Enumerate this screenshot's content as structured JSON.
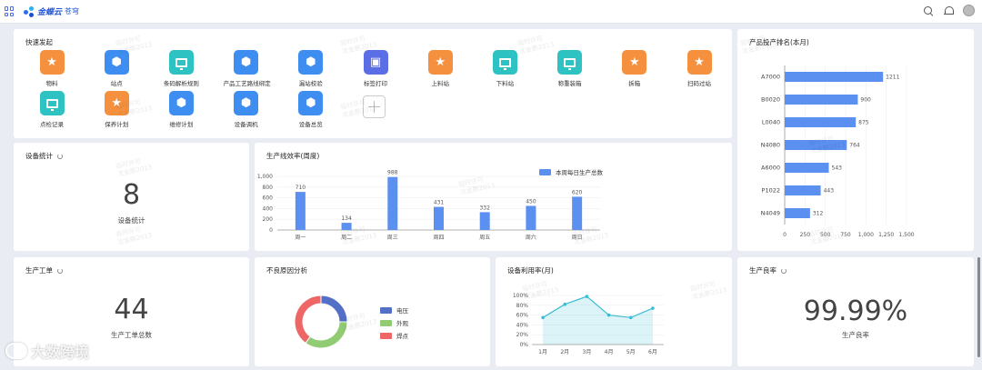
{
  "topbar": {
    "logo_text": "金蝶云",
    "logo_sub": "苍穹"
  },
  "quick_actions": {
    "title": "快速发起",
    "items": [
      {
        "label": "物料",
        "icon": "star-icon",
        "color": "#f5913e"
      },
      {
        "label": "站点",
        "icon": "cube-icon",
        "color": "#3e8ef2"
      },
      {
        "label": "条码解析规则",
        "icon": "monitor-icon",
        "color": "#2fc2c2"
      },
      {
        "label": "产品工艺路线绑定",
        "icon": "cube-icon",
        "color": "#3e8ef2"
      },
      {
        "label": "漏站校验",
        "icon": "cube-icon",
        "color": "#3e8ef2"
      },
      {
        "label": "标签打印",
        "icon": "box-icon",
        "color": "#5b6ee6"
      },
      {
        "label": "上料站",
        "icon": "star-icon",
        "color": "#f5913e"
      },
      {
        "label": "下料站",
        "icon": "monitor-icon",
        "color": "#2fc2c2"
      },
      {
        "label": "称重装箱",
        "icon": "monitor-icon",
        "color": "#2fc2c2"
      },
      {
        "label": "拆箱",
        "icon": "star-icon",
        "color": "#f5913e"
      },
      {
        "label": "扫码过站",
        "icon": "star-icon",
        "color": "#f5913e"
      },
      {
        "label": "点检记录",
        "icon": "monitor-icon",
        "color": "#2fc2c2"
      },
      {
        "label": "保养计划",
        "icon": "star-icon",
        "color": "#f5913e"
      },
      {
        "label": "维修计划",
        "icon": "cube-icon",
        "color": "#3e8ef2"
      },
      {
        "label": "设备调机",
        "icon": "cube-icon",
        "color": "#3e8ef2"
      },
      {
        "label": "设备总览",
        "icon": "cube-icon",
        "color": "#3e8ef2"
      }
    ]
  },
  "device_stats": {
    "title": "设备统计",
    "value": "8",
    "label": "设备统计"
  },
  "work_orders": {
    "title": "生产工单",
    "value": "44",
    "label": "生产工单总数"
  },
  "yield": {
    "title": "生产良率",
    "value": "99.99%",
    "label": "生产良率"
  },
  "watermark_lines": [
    "临时许可",
    "沈金鹏2013"
  ],
  "brand_overlay": "大数跨境",
  "chart_data": [
    {
      "type": "bar",
      "title": "生产线效率(周度)",
      "categories": [
        "周一",
        "周二",
        "周三",
        "周四",
        "周五",
        "周六",
        "周日"
      ],
      "series": [
        {
          "name": "本周每日生产总数",
          "values": [
            710,
            134,
            988,
            431,
            332,
            450,
            620
          ]
        }
      ],
      "ylim": [
        0,
        1000
      ],
      "yticks": [
        "0",
        "200",
        "400",
        "600",
        "800",
        "1,000"
      ],
      "color": "#5b8ff0",
      "grid": true
    },
    {
      "type": "bar",
      "orientation": "horizontal",
      "title": "产品投产排名(本月)",
      "categories": [
        "A7000",
        "B0020",
        "L0040",
        "N4080",
        "A6000",
        "P1022",
        "N4049"
      ],
      "values": [
        1211,
        900,
        875,
        764,
        543,
        443,
        312
      ],
      "xlim": [
        0,
        1500
      ],
      "xticks": [
        "0",
        "250",
        "500",
        "750",
        "1,000",
        "1,250",
        "1,500"
      ],
      "color": "#5b8ff0",
      "grid": true
    },
    {
      "type": "pie",
      "title": "不良原因分析",
      "categories": [
        "电压",
        "外观",
        "焊点"
      ],
      "values": [
        25,
        35,
        40
      ],
      "colors": [
        "#5470c6",
        "#91cc75",
        "#ee6666"
      ],
      "legend": "right"
    },
    {
      "type": "area",
      "title": "设备利用率(月)",
      "categories": [
        "1月",
        "2月",
        "3月",
        "4月",
        "5月",
        "6月"
      ],
      "values": [
        55,
        82,
        98,
        60,
        55,
        74
      ],
      "ylim": [
        0,
        100
      ],
      "yticks": [
        "0%",
        "20%",
        "40%",
        "60%",
        "80%",
        "100%"
      ],
      "color": "#3bbdd0",
      "grid": true
    }
  ]
}
